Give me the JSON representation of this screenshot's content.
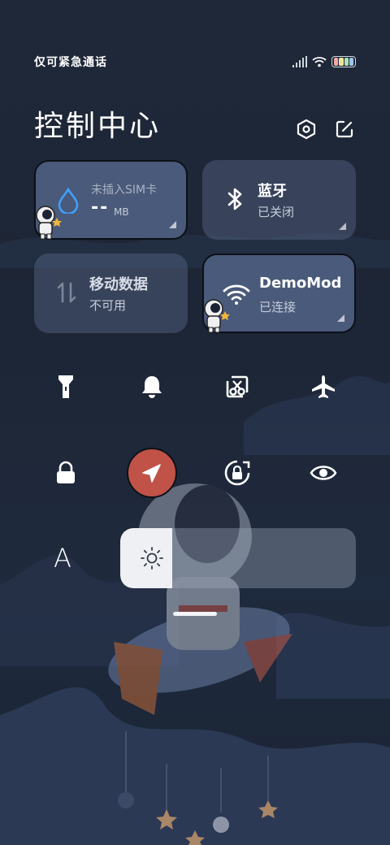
{
  "status_bar": {
    "carrier": "仅可紧急通话",
    "battery_colors": [
      "#f4a6a6",
      "#f3e29a",
      "#a8e3b6",
      "#9fc4f0"
    ]
  },
  "header": {
    "title": "控制中心",
    "settings_icon": "settings-hexagon-icon",
    "edit_icon": "edit-icon"
  },
  "tiles": {
    "data_usage": {
      "label": "未插入SIM卡",
      "value": "--",
      "unit": "MB"
    },
    "bluetooth": {
      "label": "蓝牙",
      "status": "已关闭"
    },
    "mobile_data": {
      "label": "移动数据",
      "status": "不可用"
    },
    "wifi": {
      "label": "DemoMode",
      "status": "已连接"
    }
  },
  "toggles": {
    "row1": [
      "flashlight-icon",
      "bell-icon",
      "screenshot-icon",
      "airplane-icon"
    ],
    "row2": [
      "lock-icon",
      "location-icon",
      "rotation-lock-icon",
      "eye-icon"
    ],
    "location_color": "#c05248"
  },
  "brightness": {
    "font_label": "A",
    "level": 0.22
  }
}
